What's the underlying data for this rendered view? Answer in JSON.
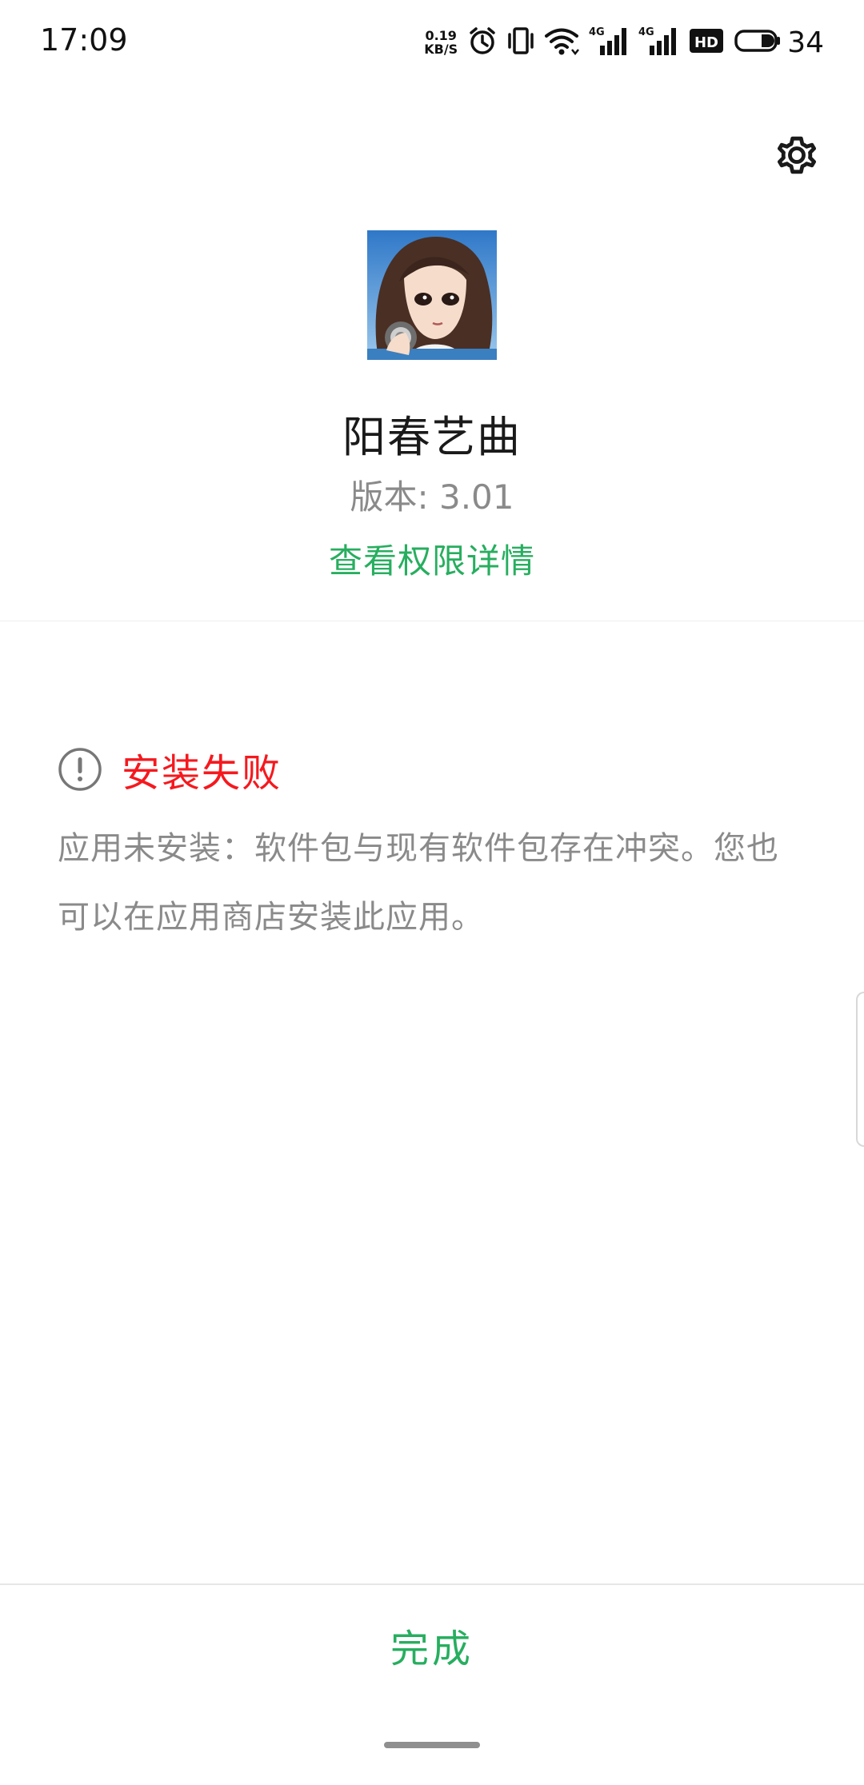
{
  "status_bar": {
    "time": "17:09",
    "net_speed_value": "0.19",
    "net_speed_unit": "KB/S",
    "battery_level": "34",
    "icons": [
      "alarm-icon",
      "vibrate-icon",
      "wifi-icon",
      "signal-4g-icon",
      "signal-4g-icon",
      "hd-icon",
      "battery-icon"
    ],
    "signal_label": "4G",
    "hd_label": "HD"
  },
  "settings": {
    "icon": "gear-icon"
  },
  "app": {
    "name": "阳春艺曲",
    "version": "版本: 3.01",
    "permissions_link": "查看权限详情"
  },
  "result": {
    "icon": "exclamation-circle-icon",
    "title": "安装失败",
    "description": "应用未安装：软件包与现有软件包存在冲突。您也可以在应用商店安装此应用。"
  },
  "footer": {
    "done_label": "完成"
  },
  "colors": {
    "accent_green": "#27ae5f",
    "error_red": "#f5191e",
    "secondary_text": "#8a8a8a"
  }
}
